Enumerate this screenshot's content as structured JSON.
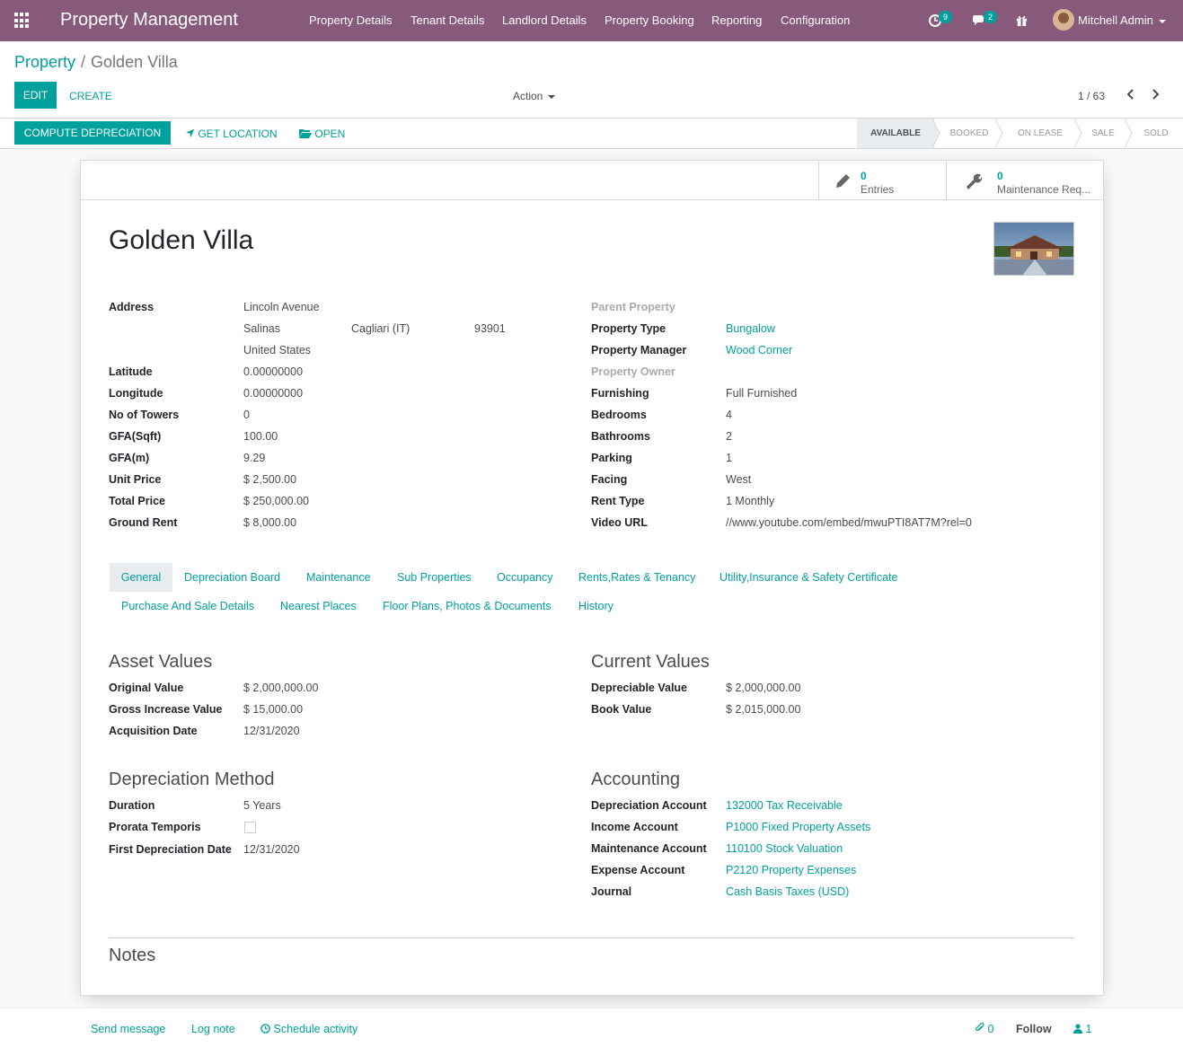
{
  "navbar": {
    "brand": "Property Management",
    "menus": [
      "Property Details",
      "Tenant Details",
      "Landlord Details",
      "Property Booking",
      "Reporting",
      "Configuration"
    ],
    "activity_count": "9",
    "message_count": "2",
    "user_name": "Mitchell Admin"
  },
  "breadcrumb": {
    "parent": "Property",
    "separator": "/",
    "current": "Golden Villa"
  },
  "control": {
    "edit": "EDIT",
    "create": "CREATE",
    "action": "Action",
    "pager": "1 / 63"
  },
  "header_buttons": {
    "compute": "COMPUTE DEPRECIATION",
    "get_location": "GET LOCATION",
    "open": "OPEN"
  },
  "status": {
    "stages": [
      "AVAILABLE",
      "BOOKED",
      "ON LEASE",
      "SALE",
      "SOLD"
    ],
    "active": "AVAILABLE"
  },
  "stat_buttons": [
    {
      "count": "0",
      "label": "Entries",
      "icon": "pencil-icon"
    },
    {
      "count": "0",
      "label": "Maintenance Req...",
      "icon": "wrench-icon"
    }
  ],
  "record": {
    "name": "Golden Villa",
    "left_fields": [
      {
        "label": "Address",
        "value": "Lincoln Avenue"
      },
      {
        "label": "",
        "value": "Salinas"
      },
      {
        "label": "",
        "value": "United States"
      },
      {
        "label": "Latitude",
        "value": "0.00000000"
      },
      {
        "label": "Longitude",
        "value": "0.00000000"
      },
      {
        "label": "No of Towers",
        "value": "0"
      },
      {
        "label": "GFA(Sqft)",
        "value": "100.00"
      },
      {
        "label": "GFA(m)",
        "value": "9.29"
      },
      {
        "label": "Unit Price",
        "value": "$ 2,500.00"
      },
      {
        "label": "Total Price",
        "value": "$ 250,000.00"
      },
      {
        "label": "Ground Rent",
        "value": "$ 8,000.00"
      }
    ],
    "address_state": "Cagliari (IT)",
    "address_zip": "93901",
    "right_fields": [
      {
        "label": "Parent Property",
        "value": "",
        "muted": true
      },
      {
        "label": "Property Type",
        "value": "Bungalow",
        "link": true
      },
      {
        "label": "Property Manager",
        "value": "Wood Corner",
        "link": true
      },
      {
        "label": "Property Owner",
        "value": "",
        "muted": true
      },
      {
        "label": "Furnishing",
        "value": "Full Furnished"
      },
      {
        "label": "Bedrooms",
        "value": "4"
      },
      {
        "label": "Bathrooms",
        "value": "2"
      },
      {
        "label": "Parking",
        "value": "1"
      },
      {
        "label": "Facing",
        "value": "West"
      },
      {
        "label": "Rent Type",
        "value": "1 Monthly"
      },
      {
        "label": "Video URL",
        "value": "//www.youtube.com/embed/mwuPTI8AT7M?rel=0"
      }
    ]
  },
  "tabs": [
    "General",
    "Depreciation Board",
    "Maintenance",
    "Sub Properties",
    "Occupancy",
    "Rents,Rates & Tenancy",
    "Utility,Insurance & Safety Certificate",
    "Purchase And Sale Details",
    "Nearest Places",
    "Floor Plans, Photos & Documents",
    "History"
  ],
  "general": {
    "asset_title": "Asset Values",
    "asset": [
      {
        "label": "Original Value",
        "value": "$ 2,000,000.00"
      },
      {
        "label": "Gross Increase Value",
        "value": "$ 15,000.00"
      },
      {
        "label": "Acquisition Date",
        "value": "12/31/2020"
      }
    ],
    "current_title": "Current Values",
    "current": [
      {
        "label": "Depreciable Value",
        "value": "$ 2,000,000.00"
      },
      {
        "label": "Book Value",
        "value": "$ 2,015,000.00"
      }
    ],
    "depreciation_title": "Depreciation Method",
    "depreciation": [
      {
        "label": "Duration",
        "value": "5  Years"
      },
      {
        "label": "Prorata Temporis",
        "value": ""
      },
      {
        "label": "First Depreciation Date",
        "value": "12/31/2020"
      }
    ],
    "accounting_title": "Accounting",
    "accounting": [
      {
        "label": "Depreciation Account",
        "value": "132000 Tax Receivable"
      },
      {
        "label": "Income Account",
        "value": "P1000 Fixed Property Assets"
      },
      {
        "label": "Maintenance Account",
        "value": "110100 Stock Valuation"
      },
      {
        "label": "Expense Account",
        "value": "P2120 Property Expenses"
      },
      {
        "label": "Journal",
        "value": "Cash Basis Taxes (USD)"
      }
    ],
    "notes_title": "Notes"
  },
  "chatter": {
    "send_message": "Send message",
    "log_note": "Log note",
    "schedule_activity": "Schedule activity",
    "attachments": "0",
    "follow": "Follow",
    "followers": "1"
  },
  "colors": {
    "brand": "#875a7b",
    "accent": "#00a09d"
  }
}
